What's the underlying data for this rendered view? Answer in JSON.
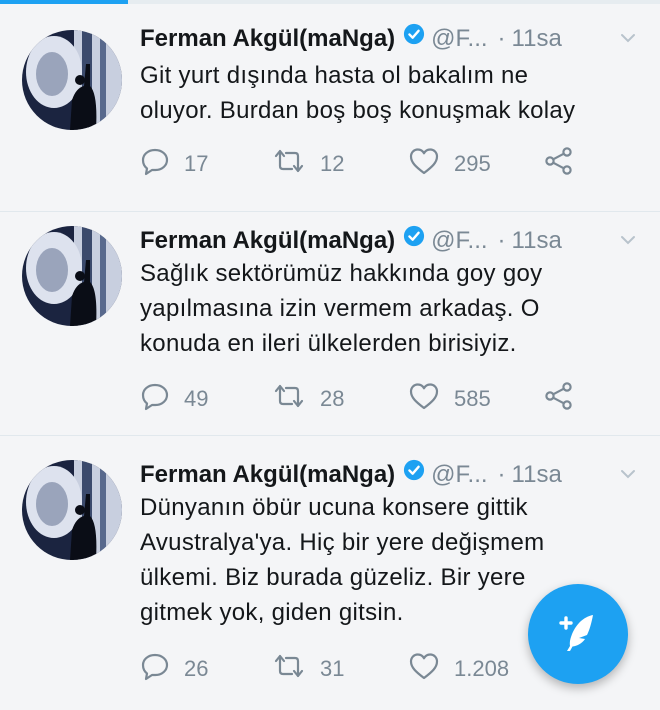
{
  "tweets": [
    {
      "author": "Ferman Akgül(maNga)",
      "handle": "@F...",
      "separator": "·",
      "time": "11sa",
      "lines": [
        "Git yurt dışında hasta ol bakalım ne",
        "oluyor. Burdan boş boş konuşmak kolay"
      ],
      "replies": "17",
      "retweets": "12",
      "likes": "295"
    },
    {
      "author": "Ferman Akgül(maNga)",
      "handle": "@F...",
      "separator": "·",
      "time": "11sa",
      "lines": [
        "Sağlık sektörümüz hakkında goy goy",
        "yapılmasına izin vermem arkadaş. O",
        "konuda en ileri ülkelerden birisiyiz."
      ],
      "replies": "49",
      "retweets": "28",
      "likes": "585"
    },
    {
      "author": "Ferman Akgül(maNga)",
      "handle": "@F...",
      "separator": "·",
      "time": "11sa",
      "lines": [
        "Dünyanın öbür ucuna konsere gittik",
        "Avustralya'ya. Hiç bir yere değişmem",
        "ülkemi. Biz burada güzeliz. Bir yere",
        "gitmek yok, giden gitsin."
      ],
      "replies": "26",
      "retweets": "31",
      "likes": "1.208"
    }
  ],
  "icons": {
    "verified": "verified-badge-icon",
    "reply": "reply-icon",
    "retweet": "retweet-icon",
    "like": "heart-icon",
    "share": "share-icon",
    "caret": "chevron-down-icon",
    "compose": "compose-tweet-icon"
  },
  "colors": {
    "accent": "#1da1f2",
    "muted": "#7a8894",
    "background": "#f4f5f7"
  }
}
